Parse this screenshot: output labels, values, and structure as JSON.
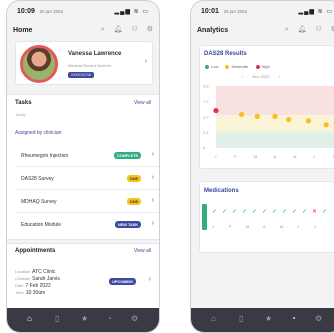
{
  "left": {
    "status": {
      "time": "10:09",
      "date": "20 jun 2022",
      "icons": "▂▄▆ ≋ ▭"
    },
    "header": {
      "title": "Home"
    },
    "profile": {
      "name": "Vanessa Lawrence",
      "meta": "Medical Record Number",
      "mrn": "XXXXXX716"
    },
    "tasks": {
      "title": "Tasks",
      "view_all": "View all",
      "today": "Today",
      "assigned": "Assigned by clinician",
      "items": [
        {
          "label": "Rheumegrin Injection",
          "status": "COMPLETE"
        },
        {
          "label": "DAS28 Survey",
          "status": "DUE"
        },
        {
          "label": "MDHAQ Survey",
          "status": "DUE"
        },
        {
          "label": "Education Module",
          "status": "NEW TASK"
        }
      ]
    },
    "appointments": {
      "title": "Appointments",
      "view_all": "View all",
      "location_label": "Location",
      "location": "ATC Clinic",
      "clinician_label": "Clinician",
      "clinician": "Sarah Jarvis",
      "date_label": "Date",
      "date": "7 Feb 2022",
      "time_label": "Time",
      "time": "10:30am",
      "status": "UPCOMING"
    }
  },
  "right": {
    "status": {
      "time": "10:01",
      "date": "25 jun 2022",
      "icons": "▂▄▆ ≋ ▭"
    },
    "header": {
      "title": "Analytics"
    },
    "das28": {
      "title": "DAS28 Results",
      "legend": [
        "Low",
        "Moderate",
        "High"
      ],
      "legend_colors": [
        "#2fae7e",
        "#f4c21f",
        "#e0334a"
      ],
      "nav_label": "Nov 2022",
      "prev": "‹",
      "next": "›"
    },
    "medications": {
      "title": "Medications",
      "marks": [
        "✓",
        "✓",
        "✓",
        "✓",
        "✓",
        "✓",
        "✓",
        "✓",
        "✓",
        "✓",
        "✕",
        "✓"
      ]
    }
  },
  "chart_data": {
    "type": "scatter",
    "title": "DAS28 Results",
    "categories": [
      "J",
      "F",
      "M",
      "A",
      "M",
      "J",
      "J"
    ],
    "y_ticks": [
      "9.6",
      "7.2",
      "4.7",
      "2.4",
      "0"
    ],
    "ylim": [
      0,
      9.6
    ],
    "bands": [
      {
        "name": "Low",
        "from": 0,
        "to": 2.6,
        "color": "#e2efe6"
      },
      {
        "name": "Moderate",
        "from": 2.6,
        "to": 5.1,
        "color": "#fbf3d6"
      },
      {
        "name": "High",
        "from": 5.1,
        "to": 9.6,
        "color": "#f9e1e1"
      }
    ],
    "points": [
      {
        "x": 0,
        "y": 5.8,
        "color": "#e0334a"
      },
      {
        "x": 1.3,
        "y": 5.2,
        "color": "#f4c21f"
      },
      {
        "x": 2.1,
        "y": 4.9,
        "color": "#f4c21f"
      },
      {
        "x": 3.0,
        "y": 4.9,
        "color": "#f4c21f"
      },
      {
        "x": 3.7,
        "y": 4.4,
        "color": "#f4c21f"
      },
      {
        "x": 4.7,
        "y": 4.2,
        "color": "#f4c21f"
      },
      {
        "x": 5.6,
        "y": 3.6,
        "color": "#f4c21f"
      }
    ]
  }
}
